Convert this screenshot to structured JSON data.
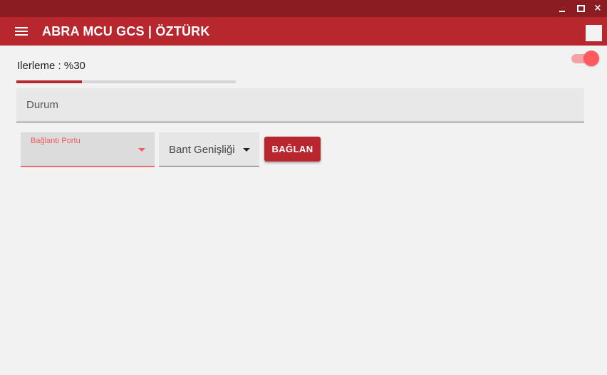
{
  "window": {
    "minimize_label": "minimize",
    "maximize_label": "maximize",
    "close_label": "×"
  },
  "appbar": {
    "title": "ABRA MCU GCS | ÖZTÜRK",
    "menu_icon": "hamburger-menu-icon"
  },
  "progress": {
    "label": "Ilerleme : %30",
    "percent": 30,
    "color": "#b8262e"
  },
  "toggle": {
    "state": "on",
    "thumb_color": "#ff5a60",
    "track_color": "#f4a3a5"
  },
  "status_field": {
    "placeholder": "Durum"
  },
  "connection": {
    "port_label": "Bağlantı Portu",
    "bandwidth_label": "Bant Genişliği",
    "connect_button": "BAĞLAN"
  },
  "colors": {
    "titlebar": "#8b1c22",
    "appbar": "#b8262e",
    "accent": "#ef5a60",
    "background": "#f2f2f2"
  }
}
